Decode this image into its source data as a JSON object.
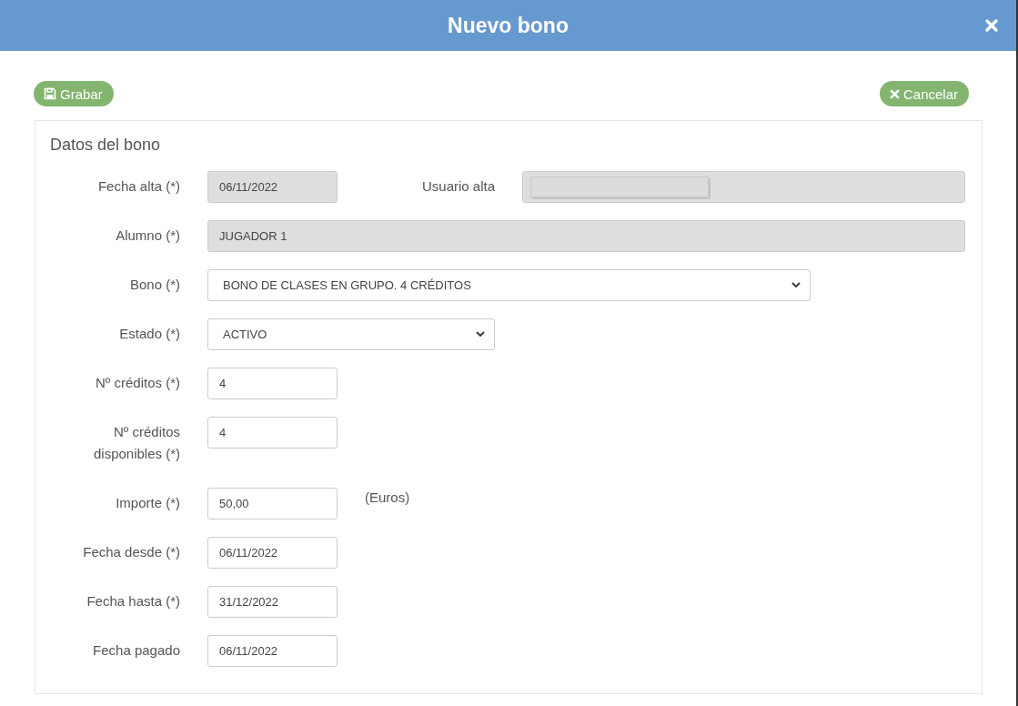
{
  "dialog": {
    "title": "Nuevo bono"
  },
  "toolbar": {
    "save_button": "Grabar",
    "cancel_button": "Cancelar"
  },
  "section": {
    "title": "Datos del bono"
  },
  "rows": [
    {
      "fields": [
        {
          "label": "Fecha alta (*)",
          "kind": "text",
          "value": "06/11/2022",
          "disabled": true
        },
        {
          "label": "Usuario alta",
          "kind": "empty",
          "disabled": true
        }
      ]
    },
    {
      "fields": [
        {
          "label": "Alumno (*)",
          "kind": "wide",
          "value": "JUGADOR 1",
          "disabled": true
        }
      ]
    },
    {
      "fields": [
        {
          "label": "Bono (*)",
          "kind": "select",
          "value": "BONO DE CLASES EN GRUPO. 4 CRÉDITOS",
          "disabled": false
        }
      ]
    },
    {
      "fields": [
        {
          "label": "Estado (*)",
          "kind": "select",
          "value": "ACTIVO",
          "disabled": false
        }
      ]
    },
    {
      "fields": [
        {
          "label": "Nº créditos (*)",
          "kind": "text",
          "value": "4",
          "disabled": false
        }
      ]
    },
    {
      "fields": [
        {
          "label": "Nº créditos disponibles (*)",
          "kind": "text",
          "value": "4",
          "disabled": false
        }
      ]
    },
    {
      "fields": [
        {
          "label": "Importe (*)",
          "kind": "text",
          "value": "50,00",
          "disabled": false,
          "suffix": "(Euros)"
        }
      ]
    },
    {
      "fields": [
        {
          "label": "Fecha desde (*)",
          "kind": "text",
          "value": "06/11/2022",
          "disabled": false
        }
      ]
    },
    {
      "fields": [
        {
          "label": "Fecha hasta (*)",
          "kind": "text",
          "value": "31/12/2022",
          "disabled": false
        }
      ]
    },
    {
      "fields": [
        {
          "label": "Fecha pagado",
          "kind": "text",
          "value": "06/11/2022",
          "disabled": false
        }
      ]
    }
  ]
}
